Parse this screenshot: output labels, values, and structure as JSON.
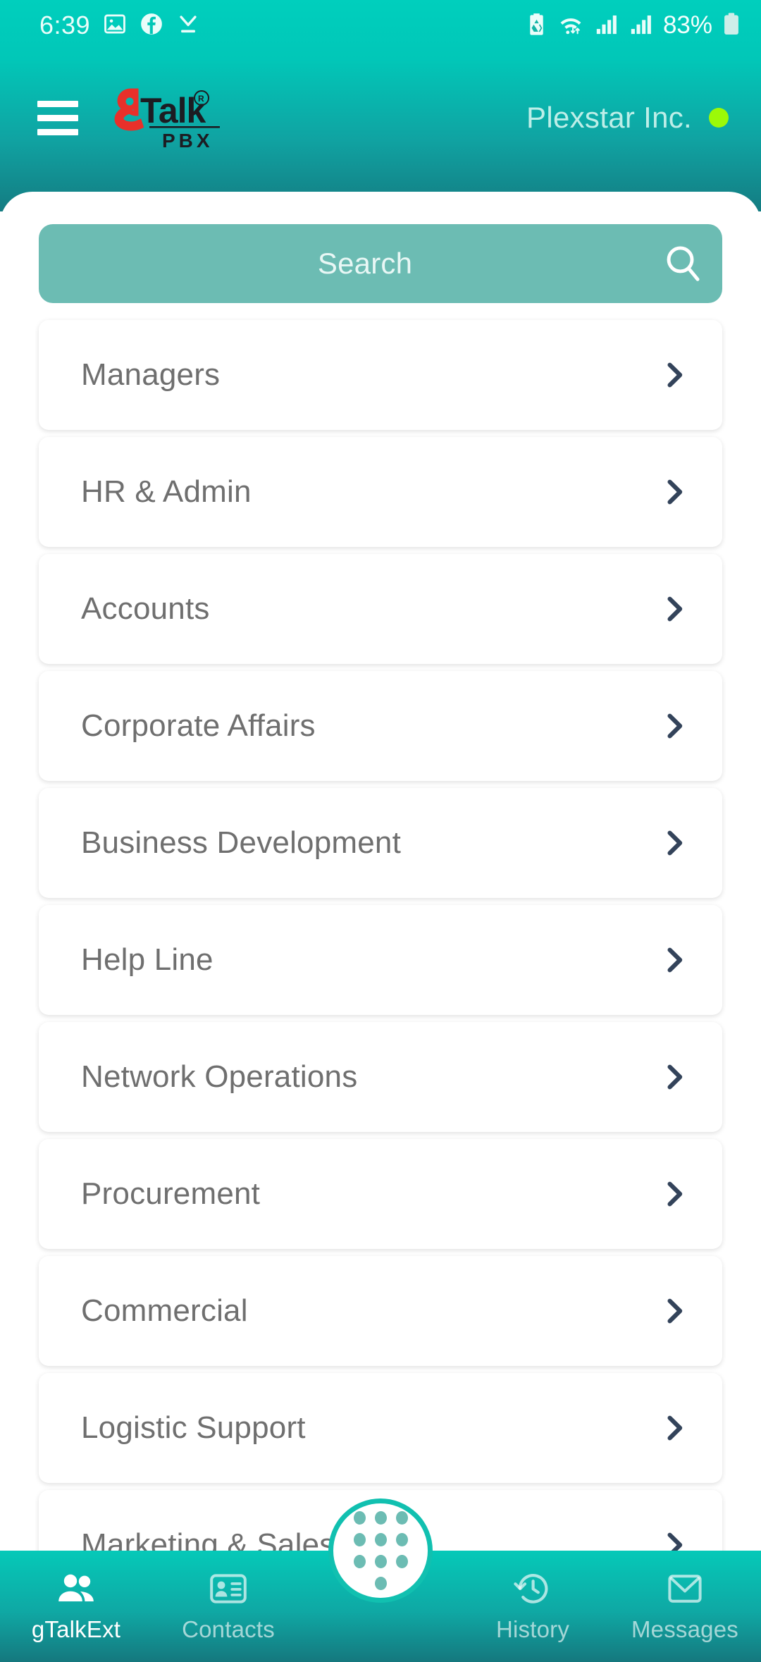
{
  "statusbar": {
    "time": "6:39",
    "battery_percent": "83%",
    "left_icons": [
      "photo-icon",
      "facebook-icon",
      "download-complete-icon"
    ],
    "right_icons": [
      "battery-saver-icon",
      "wifi-icon",
      "signal-sim1-icon",
      "signal-sim2-icon",
      "battery-icon"
    ]
  },
  "appbar": {
    "menu_icon": "hamburger-menu-icon",
    "logo": {
      "mark": "g",
      "word": "Talk",
      "registered": "R",
      "sub": "PBX"
    },
    "company_name": "Plexstar Inc.",
    "status_dot_color": "#9CF908"
  },
  "search": {
    "placeholder": "Search",
    "value": "",
    "icon": "search-icon"
  },
  "departments": [
    {
      "label": "Managers"
    },
    {
      "label": "HR & Admin"
    },
    {
      "label": "Accounts"
    },
    {
      "label": "Corporate Affairs"
    },
    {
      "label": "Business Development"
    },
    {
      "label": "Help Line"
    },
    {
      "label": "Network Operations"
    },
    {
      "label": "Procurement"
    },
    {
      "label": "Commercial"
    },
    {
      "label": "Logistic Support"
    },
    {
      "label": "Marketing & Sales"
    }
  ],
  "bottom_nav": {
    "items": [
      {
        "label": "gTalkExt",
        "icon": "people-icon",
        "active": true
      },
      {
        "label": "Contacts",
        "icon": "contact-card-icon",
        "active": false
      },
      {
        "label": "History",
        "icon": "history-clock-icon",
        "active": false
      },
      {
        "label": "Messages",
        "icon": "envelope-icon",
        "active": false
      }
    ],
    "fab": {
      "icon": "dialpad-icon"
    }
  },
  "colors": {
    "brand_teal": "#00CFBD",
    "brand_teal_dark": "#147C82",
    "search_bg": "#6CBCB3",
    "label_gray": "#6F6F6F",
    "chevron": "#33435A",
    "status_dot": "#9CF908"
  }
}
